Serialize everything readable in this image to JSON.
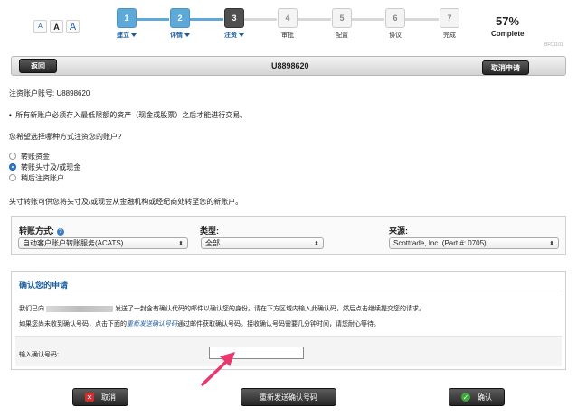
{
  "font_size": {
    "small": "A",
    "medium": "A",
    "large": "A"
  },
  "steps": [
    {
      "num": "1",
      "label": "建立"
    },
    {
      "num": "2",
      "label": "详情"
    },
    {
      "num": "3",
      "label": "注资"
    },
    {
      "num": "4",
      "label": "审批"
    },
    {
      "num": "5",
      "label": "配置"
    },
    {
      "num": "6",
      "label": "协议"
    },
    {
      "num": "7",
      "label": "完成"
    }
  ],
  "progress": {
    "percent_text": "57%",
    "complete_text": "Complete",
    "fraction": 0.57
  },
  "page_code": "BFC1101",
  "header": {
    "back_label": "返回",
    "account_title": "U8898620",
    "cancel_label": "取消申请"
  },
  "account_line": "注资账户账号: U8898620",
  "notice": "所有新账户必须存入最低限额的资产（现金或股票）之后才能进行交易。",
  "question": "您希望选择哪种方式注资您的账户?",
  "options": [
    {
      "label": "转账资金",
      "selected": false
    },
    {
      "label": "转账头寸及/或现金",
      "selected": true
    },
    {
      "label": "稍后注资账户",
      "selected": false
    }
  ],
  "transfer_desc": "头寸转账可供您将头寸及/或现金从金融机构或经纪商处转至您的新账户。",
  "transfer": {
    "method_label": "转账方式:",
    "method_value": "自动客户账户转账服务(ACATS)",
    "type_label": "类型:",
    "type_value": "全部",
    "source_label": "来源:",
    "source_value": "Scottrade, Inc. (Part #: 0705)"
  },
  "confirm": {
    "title": "确认您的申请",
    "line1_prefix": "我们已向",
    "line1_suffix": "发送了一封含有确认代码的邮件以确认您的身份。请在下方区域内输入此确认码，然后点击继续提交您的请求。",
    "line2_prefix": "如果您尚未收到确认号码，点击下面的",
    "line2_link": "重新发送确认号码",
    "line2_suffix": "通过邮件获取确认号码。接收确认号码需要几分钟时间，请您耐心等待。",
    "input_label": "输入确认号码:",
    "input_value": ""
  },
  "buttons": {
    "cancel": "取消",
    "resend": "重新发送确认号码",
    "confirm": "确认"
  },
  "colors": {
    "accent": "#5fa9d9",
    "current": "#505050",
    "arrow": "#e8386e",
    "link": "#1b5d9c"
  }
}
